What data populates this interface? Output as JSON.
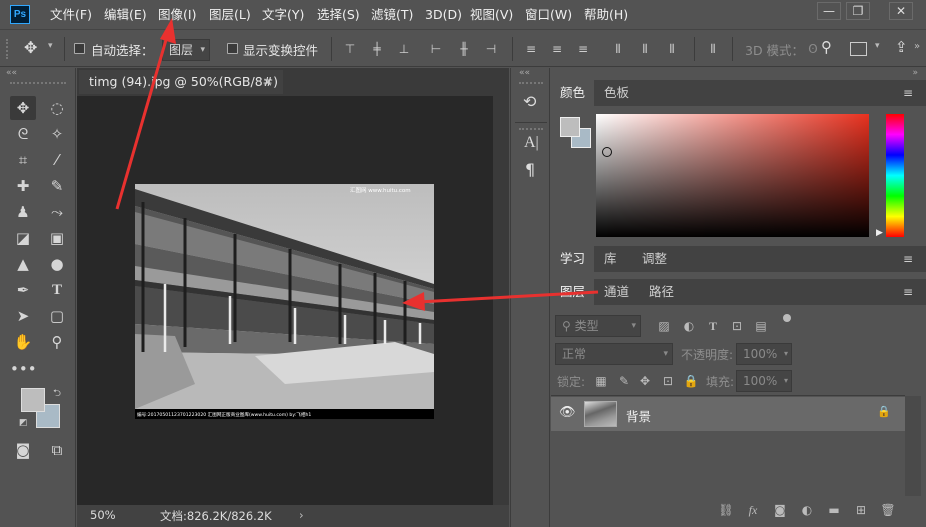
{
  "app": {
    "logo": "Ps",
    "menu": [
      "文件(F)",
      "编辑(E)",
      "图像(I)",
      "图层(L)",
      "文字(Y)",
      "选择(S)",
      "滤镜(T)",
      "3D(D)",
      "视图(V)",
      "窗口(W)",
      "帮助(H)"
    ],
    "window_controls": [
      "—",
      "❐",
      "✕"
    ]
  },
  "options": {
    "auto_select_label": "自动选择：",
    "layer_dropdown": "图层",
    "show_transform_label": "显示变换控件",
    "mode_3d_label": "3D 模式："
  },
  "document": {
    "tab_title": "timg (94).jpg @ 50%(RGB/8#) *",
    "close": "×",
    "zoom": "50%",
    "doc_info": "文档:826.2K/826.2K",
    "watermark_top": "汇图网 www.huitu.com",
    "watermark_bottom": "编号:20170501123701223020   汇图网正版商业图库(www.huitu.com)  by:飞相h1"
  },
  "panels": {
    "color_tabs": [
      "颜色",
      "色板"
    ],
    "learn_tabs": [
      "学习",
      "库",
      "调整"
    ],
    "layer_tabs": [
      "图层",
      "通道",
      "路径"
    ],
    "filter_kind": "类型",
    "blend_mode": "正常",
    "opacity_label": "不透明度:",
    "opacity_value": "100%",
    "lock_label": "锁定:",
    "fill_label": "填充:",
    "fill_value": "100%",
    "layer_name": "背景"
  },
  "colors": {
    "accent": "#31a8ff",
    "arrow": "#e8312f",
    "foreground": "#bdbdbd",
    "background": "#a9bac6",
    "picker_hue": "#e8311f"
  }
}
